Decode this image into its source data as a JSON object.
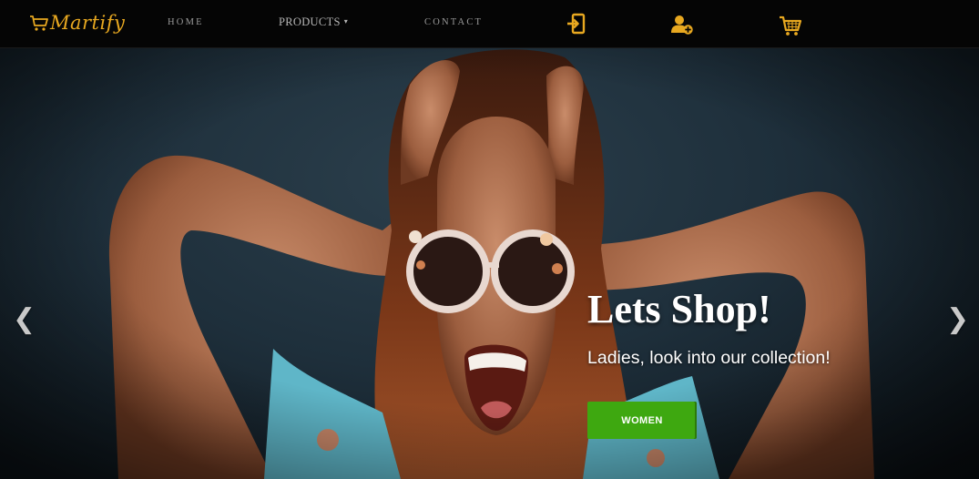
{
  "brand": {
    "name": "Martify",
    "icon": "shopping-cart-icon",
    "color": "#e8a820"
  },
  "nav": {
    "home": "HOME",
    "products": "PRODUCTS",
    "products_caret": "▾",
    "contact": "CONTACT",
    "icons": [
      "login-icon",
      "add-user-icon",
      "cart-icon"
    ],
    "icon_color": "#e8a820"
  },
  "hero": {
    "title": "Lets Shop!",
    "subtitle": "Ladies, look into our collection!",
    "button_label": "WOMEN",
    "button_color": "#3ea810",
    "prev_arrow": "❮",
    "next_arrow": "❯"
  }
}
